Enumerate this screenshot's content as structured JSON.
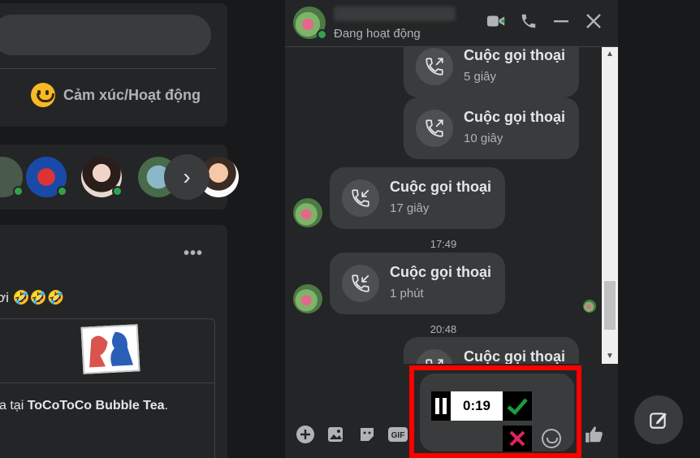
{
  "feed": {
    "composer": {
      "feeling_label": "Cảm xúc/Hoạt động"
    },
    "post": {
      "more_label": "•••",
      "caption": "ơi 🤣🤣🤣",
      "embed_prefix": "a tại ",
      "embed_place": "ToCoToCo Bubble Tea",
      "embed_suffix": "."
    },
    "stories_next_label": "›"
  },
  "chat": {
    "header": {
      "status": "Đang hoạt động"
    },
    "messages": [
      {
        "title": "Cuộc gọi thoại",
        "duration": "5 giây"
      },
      {
        "title": "Cuộc gọi thoại",
        "duration": "10 giây"
      },
      {
        "title": "Cuộc gọi thoại",
        "duration": "17 giây"
      },
      {
        "title": "Cuộc gọi thoại",
        "duration": "1 phút"
      },
      {
        "title": "Cuộc gọi thoại",
        "duration": ""
      }
    ],
    "timestamps": [
      "17:49",
      "20:48"
    ],
    "recording": {
      "time": "0:19"
    }
  },
  "colors": {
    "accent": "#31a24c",
    "highlight": "#ff0000",
    "confirm": "#1a9e3a",
    "cancel": "#e0245e"
  }
}
